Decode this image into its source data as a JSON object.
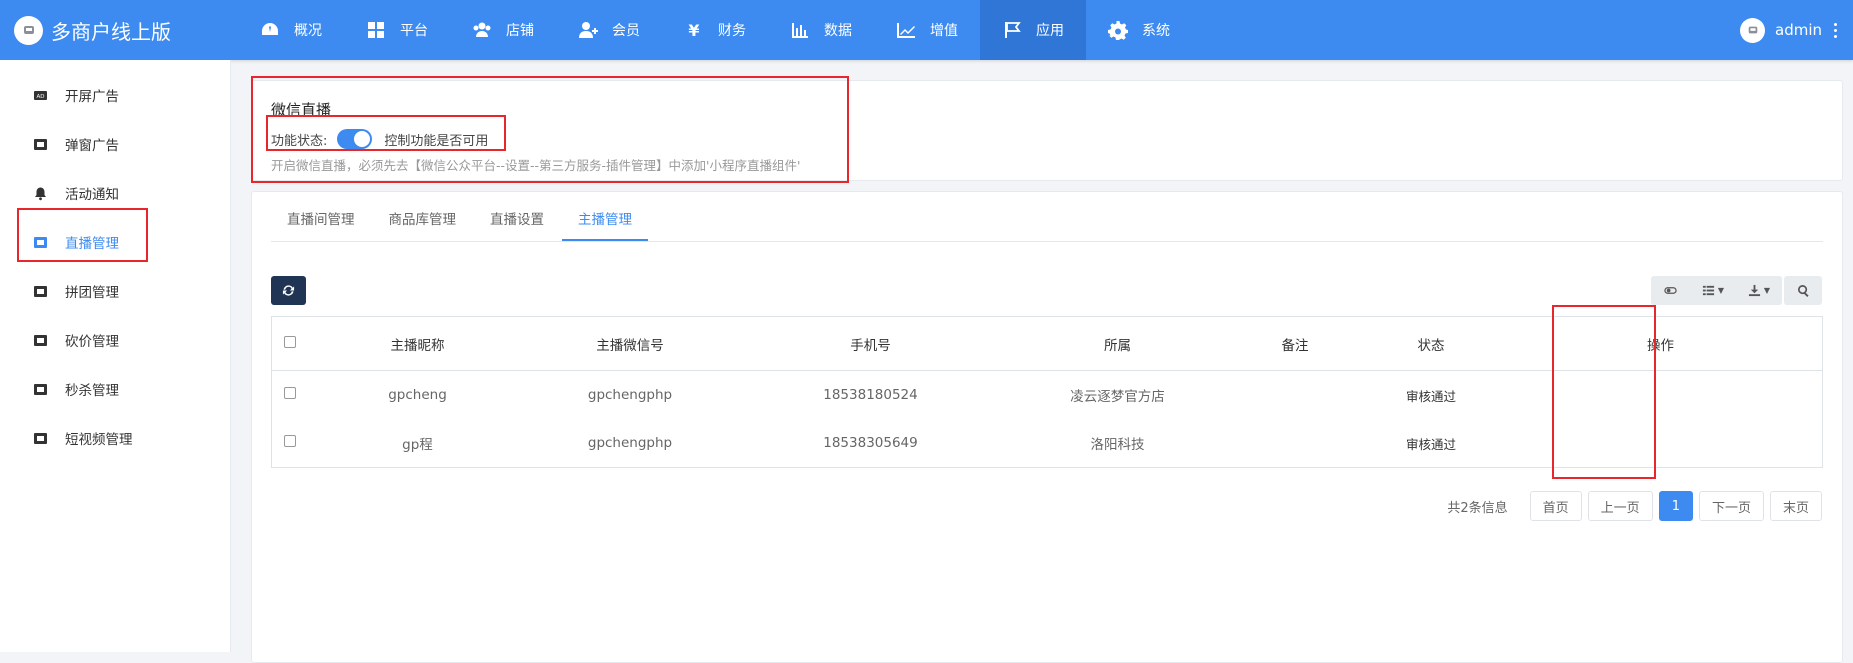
{
  "brand": {
    "title": "多商户线上版"
  },
  "nav": [
    {
      "label": "概况",
      "icon": "dashboard-icon"
    },
    {
      "label": "平台",
      "icon": "grid-icon"
    },
    {
      "label": "店铺",
      "icon": "users-icon"
    },
    {
      "label": "会员",
      "icon": "user-plus-icon"
    },
    {
      "label": "财务",
      "icon": "yen-icon"
    },
    {
      "label": "数据",
      "icon": "bar-chart-icon"
    },
    {
      "label": "增值",
      "icon": "line-chart-icon"
    },
    {
      "label": "应用",
      "icon": "flag-icon",
      "active": true
    },
    {
      "label": "系统",
      "icon": "gear-icon"
    }
  ],
  "user": {
    "name": "admin"
  },
  "sidebar": {
    "items": [
      {
        "label": "开屏广告",
        "icon": "ad-icon"
      },
      {
        "label": "弹窗广告",
        "icon": "popup-icon"
      },
      {
        "label": "活动通知",
        "icon": "bell-icon"
      },
      {
        "label": "直播管理",
        "icon": "live-icon",
        "active": true
      },
      {
        "label": "拼团管理",
        "icon": "group-icon"
      },
      {
        "label": "砍价管理",
        "icon": "bargain-icon"
      },
      {
        "label": "秒杀管理",
        "icon": "flash-sale-icon"
      },
      {
        "label": "短视频管理",
        "icon": "video-icon"
      }
    ]
  },
  "live_panel": {
    "title": "微信直播",
    "status_label": "功能状态:",
    "toggle_on": true,
    "toggle_desc": "控制功能是否可用",
    "hint": "开启微信直播，必须先去【微信公众平台--设置--第三方服务-插件管理】中添加'小程序直播组件'"
  },
  "tabs": [
    {
      "label": "直播间管理"
    },
    {
      "label": "商品库管理"
    },
    {
      "label": "直播设置"
    },
    {
      "label": "主播管理",
      "active": true
    }
  ],
  "table": {
    "columns": [
      "主播昵称",
      "主播微信号",
      "手机号",
      "所属",
      "备注",
      "状态",
      "操作"
    ],
    "rows": [
      {
        "nickname": "gpcheng",
        "wechat": "gpchengphp",
        "phone": "18538180524",
        "belong": "凌云逐梦官方店",
        "remark": "",
        "status": "审核通过",
        "action": ""
      },
      {
        "nickname": "gp程",
        "wechat": "gpchengphp",
        "phone": "18538305649",
        "belong": "洛阳科技",
        "remark": "",
        "status": "审核通过",
        "action": ""
      }
    ]
  },
  "pager": {
    "info": "共2条信息",
    "first": "首页",
    "prev": "上一页",
    "current": "1",
    "next": "下一页",
    "last": "末页"
  },
  "colors": {
    "primary": "#3d8bf0",
    "annotation": "#e8262b",
    "dark_button": "#1f3553"
  }
}
